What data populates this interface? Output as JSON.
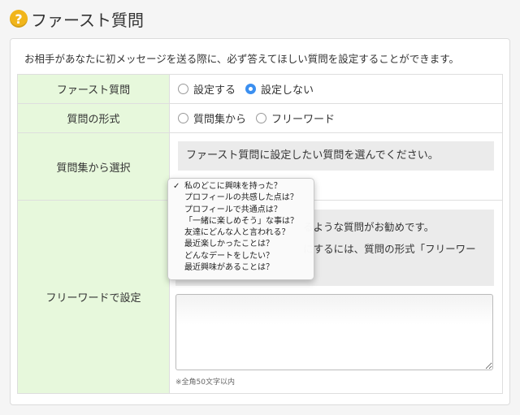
{
  "header": {
    "title": "ファースト質問",
    "icon": "question-circle-icon"
  },
  "intro": "お相手があなたに初メッセージを送る際に、必ず答えてほしい質問を設定することができます。",
  "rows": {
    "first_question": {
      "label": "ファースト質問",
      "options": [
        "設定する",
        "設定しない"
      ],
      "selected": "設定しない"
    },
    "format": {
      "label": "質問の形式",
      "options": [
        "質問集から",
        "フリーワード"
      ],
      "selected": ""
    },
    "from_list": {
      "label": "質問集から選択",
      "select_text": "ファースト質問に設定したい質問を選んでください。"
    },
    "free_word": {
      "label": "フリーワードで設定",
      "hint_line1": "るような質問がお勧めです。",
      "hint_line2": "にするには、質問の形式「フリーワー",
      "textarea_value": "",
      "note": "※全角50文字以内"
    }
  },
  "dropdown": {
    "selected_index": 0,
    "check": "✓",
    "items": [
      "私のどこに興味を持った？",
      "プロフィールの共感した点は？",
      "プロフィールで共通点は？",
      "「一緒に楽しめそう」な事は？",
      "友達にどんな人と言われる？",
      "最近楽しかったことは？",
      "どんなデートをしたい？",
      "最近興味があることは？"
    ]
  },
  "colors": {
    "label_bg": "#e7f8dc",
    "radio_selected": "#3b8ff0",
    "icon_bg": "#f1b51b"
  }
}
